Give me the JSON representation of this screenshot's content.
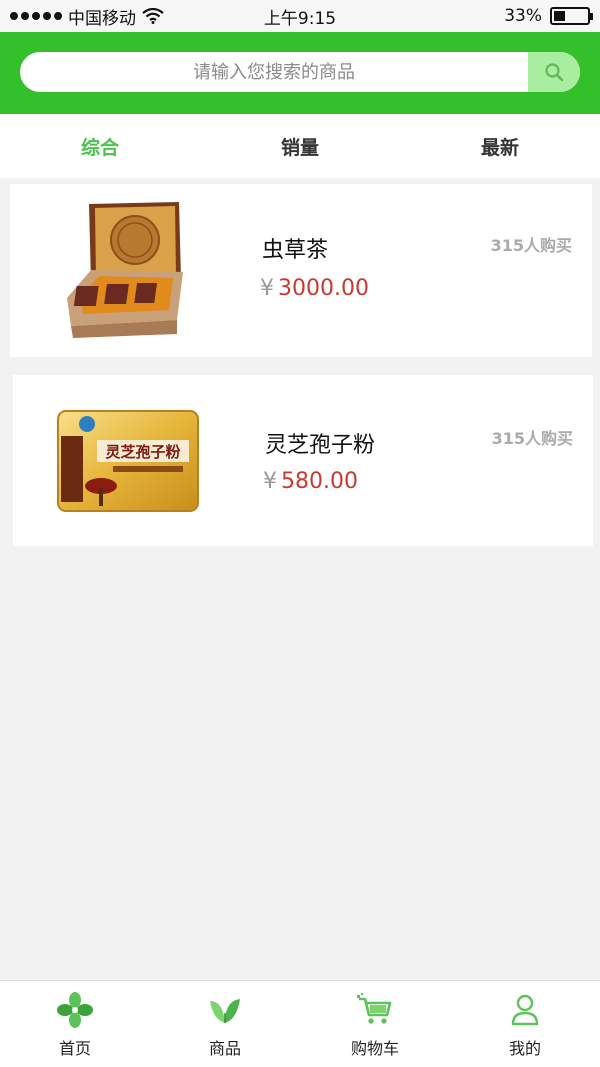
{
  "status_bar": {
    "carrier": "中国移动",
    "time": "上午9:15",
    "battery": "33%",
    "battery_level": 0.33
  },
  "search": {
    "placeholder": "请输入您搜索的商品"
  },
  "tabs": [
    {
      "label": "综合",
      "active": true
    },
    {
      "label": "销量",
      "active": false
    },
    {
      "label": "最新",
      "active": false
    }
  ],
  "products": [
    {
      "name": "虫草茶",
      "currency": "¥",
      "price": "3000.00",
      "sold": "315人购买"
    },
    {
      "name": "灵芝孢子粉",
      "currency": "¥",
      "price": "580.00",
      "sold": "315人购买"
    }
  ],
  "product_box_text": {
    "lingzhi_title": "灵芝孢子粉"
  },
  "bottom_nav": [
    {
      "label": "首页",
      "icon": "home-pinwheel-icon"
    },
    {
      "label": "商品",
      "icon": "leaf-icon"
    },
    {
      "label": "购物车",
      "icon": "cart-icon"
    },
    {
      "label": "我的",
      "icon": "user-icon"
    }
  ],
  "colors": {
    "header_green": "#34c02b",
    "active_tab": "#4cc14c",
    "price_red": "#c83a2f"
  }
}
